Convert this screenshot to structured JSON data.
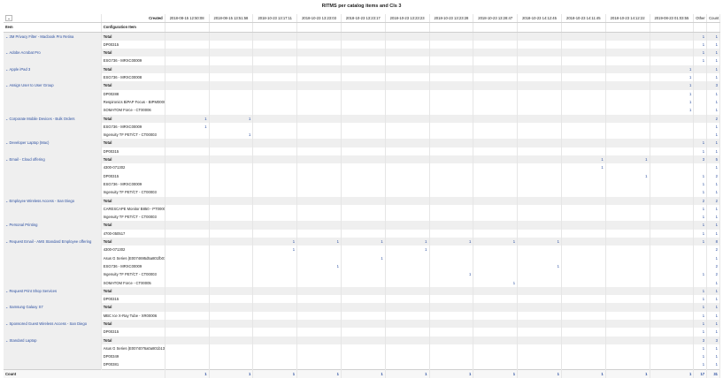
{
  "report_title": "RITMS per catalog items and Cls 3",
  "filter_icon": "chevron-down-icon",
  "header": {
    "created_label": "Created",
    "item_label": "Item",
    "config_label": "Configuration Item",
    "other_label": "Other",
    "count_label": "Count"
  },
  "date_columns": [
    "2018-08-15 12:50:08",
    "2018-08-15 13:51:58",
    "2018-10-23 13:17:11",
    "2018-10-23 13:23:03",
    "2018-10-23 13:23:17",
    "2018-10-23 13:23:23",
    "2018-10-23 13:23:28",
    "2018-10-23 13:28:47",
    "2018-10-23 14:12:45",
    "2018-10-23 14:11:45",
    "2018-10-23 14:12:22",
    "2019-08-23 01:03:55"
  ],
  "groups": [
    {
      "item": "3M Privacy Filter - Macbook Pro Retina",
      "rows": [
        {
          "ci": "Total",
          "vals": {},
          "other": "1",
          "count": "1"
        },
        {
          "ci": "DP00315",
          "vals": {},
          "other": "1",
          "count": "1"
        }
      ]
    },
    {
      "item": "Adobe Acrobat Pro",
      "rows": [
        {
          "ci": "Total",
          "vals": {},
          "other": "1",
          "count": "1"
        },
        {
          "ci": "ESG736 - MRXC00009",
          "vals": {},
          "other": "1",
          "count": "1"
        }
      ]
    },
    {
      "item": "Apple iPad 3",
      "rows": [
        {
          "ci": "Total",
          "vals": {
            "11": "1"
          },
          "other": "",
          "count": "1"
        },
        {
          "ci": "ESG736 - MRXC00008",
          "vals": {
            "11": "1"
          },
          "other": "",
          "count": "1"
        }
      ]
    },
    {
      "item": "Assign User to User Group",
      "rows": [
        {
          "ci": "Total",
          "vals": {
            "11": "1"
          },
          "other": "",
          "count": "3"
        },
        {
          "ci": "DP00288",
          "vals": {
            "11": "1"
          },
          "other": "",
          "count": "1"
        },
        {
          "ci": "Respironics BiPAP Focus - BIPM00002",
          "vals": {
            "11": "1"
          },
          "other": "",
          "count": "1"
        },
        {
          "ci": "SOMATOM Force - CT00006",
          "vals": {
            "11": "1"
          },
          "other": "",
          "count": "1"
        }
      ]
    },
    {
      "item": "Corporate Mobile Devices - Bulk Orders",
      "rows": [
        {
          "ci": "Total",
          "vals": {
            "0": "1",
            "1": "1"
          },
          "other": "",
          "count": "2"
        },
        {
          "ci": "ESG736 - MRXC00009",
          "vals": {
            "0": "1"
          },
          "other": "",
          "count": "1"
        },
        {
          "ci": "Ingenuity TF PET/CT - CT00003",
          "vals": {
            "1": "1"
          },
          "other": "",
          "count": "1"
        }
      ]
    },
    {
      "item": "Developer Laptop (Mac)",
      "rows": [
        {
          "ci": "Total",
          "vals": {},
          "other": "1",
          "count": "1"
        },
        {
          "ci": "DP00315",
          "vals": {},
          "other": "1",
          "count": "1"
        }
      ]
    },
    {
      "item": "Email - Cloud offering",
      "rows": [
        {
          "ci": "Total",
          "vals": {
            "9": "1",
            "10": "1"
          },
          "other": "3",
          "count": "5"
        },
        {
          "ci": "4300-071302",
          "vals": {
            "9": "1"
          },
          "other": "",
          "count": "1"
        },
        {
          "ci": "DP00315",
          "vals": {
            "10": "1"
          },
          "other": "1",
          "count": "2"
        },
        {
          "ci": "ESG736 - MRXC00009",
          "vals": {},
          "other": "1",
          "count": "1"
        },
        {
          "ci": "Ingenuity TF PET/CT - CT00003",
          "vals": {},
          "other": "1",
          "count": "1"
        }
      ]
    },
    {
      "item": "Employee Wireless Access - San Diego",
      "rows": [
        {
          "ci": "Total",
          "vals": {},
          "other": "2",
          "count": "2"
        },
        {
          "ci": "CARESCAPE Monitor B850 - PT00002",
          "vals": {},
          "other": "1",
          "count": "1"
        },
        {
          "ci": "Ingenuity TF PET/CT - CT00003",
          "vals": {},
          "other": "1",
          "count": "1"
        }
      ]
    },
    {
      "item": "Personal Printing",
      "rows": [
        {
          "ci": "Total",
          "vals": {},
          "other": "1",
          "count": "1"
        },
        {
          "ci": "4700-050517",
          "vals": {},
          "other": "1",
          "count": "1"
        }
      ]
    },
    {
      "item": "Request Email - AMS Standard Employee offering",
      "rows": [
        {
          "ci": "Total",
          "vals": {
            "2": "1",
            "3": "1",
            "4": "1",
            "5": "1",
            "6": "1",
            "7": "1",
            "8": "1"
          },
          "other": "1",
          "count": "8"
        },
        {
          "ci": "4300-071302",
          "vals": {
            "2": "1",
            "5": "1"
          },
          "other": "",
          "count": "2"
        },
        {
          "ci": "Asus G Series (E0074695d5a801fb010f7fa7faaacd)",
          "vals": {
            "4": "1"
          },
          "other": "",
          "count": "1"
        },
        {
          "ci": "ESG736 - MRXC00009",
          "vals": {
            "3": "1",
            "8": "1"
          },
          "other": "",
          "count": "2"
        },
        {
          "ci": "Ingenuity TF PET/CT - CT00003",
          "vals": {
            "6": "1"
          },
          "other": "1",
          "count": "2"
        },
        {
          "ci": "SOMATOM Force - CT00005",
          "vals": {
            "7": "1"
          },
          "other": "",
          "count": "1"
        }
      ]
    },
    {
      "item": "Request Print Shop Services",
      "rows": [
        {
          "ci": "Total",
          "vals": {},
          "other": "1",
          "count": "1"
        },
        {
          "ci": "DP00315",
          "vals": {},
          "other": "1",
          "count": "1"
        }
      ]
    },
    {
      "item": "Samsung Galaxy S7",
      "rows": [
        {
          "ci": "Total",
          "vals": {},
          "other": "1",
          "count": "1"
        },
        {
          "ci": "MBC Ice X-Ray Tube - XR00006",
          "vals": {},
          "other": "1",
          "count": "1"
        }
      ]
    },
    {
      "item": "Sponsored Guest Wireless Access - San Diego",
      "rows": [
        {
          "ci": "Total",
          "vals": {},
          "other": "1",
          "count": "1"
        },
        {
          "ci": "DP00315",
          "vals": {},
          "other": "1",
          "count": "1"
        }
      ]
    },
    {
      "item": "Standard Laptop",
      "rows": [
        {
          "ci": "Total",
          "vals": {},
          "other": "3",
          "count": "3"
        },
        {
          "ci": "Asus G Series (E0074076a0a801b134e0f1e1d9ebc03)",
          "vals": {},
          "other": "1",
          "count": "1"
        },
        {
          "ci": "DP00349",
          "vals": {},
          "other": "1",
          "count": "1"
        },
        {
          "ci": "DP00381",
          "vals": {},
          "other": "1",
          "count": "1"
        }
      ]
    }
  ],
  "footer": {
    "label": "Count",
    "vals": [
      "1",
      "1",
      "1",
      "1",
      "1",
      "1",
      "1",
      "1",
      "1",
      "1",
      "1",
      "1"
    ],
    "other": "17",
    "count": "31"
  }
}
